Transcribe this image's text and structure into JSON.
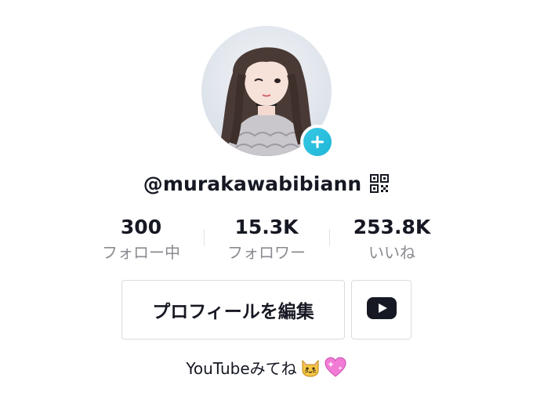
{
  "profile": {
    "username": "@murakawabibiann",
    "bio_text": "YouTubeみてね",
    "bio_emojis": [
      "cat-face-icon",
      "sparkling-heart-icon"
    ]
  },
  "stats": [
    {
      "value": "300",
      "label": "フォロー中"
    },
    {
      "value": "15.3K",
      "label": "フォロワー"
    },
    {
      "value": "253.8K",
      "label": "いいね"
    }
  ],
  "actions": {
    "edit_profile_label": "プロフィールを編集",
    "youtube_icon": "youtube-icon"
  },
  "icons": {
    "avatar_add": "plus-icon",
    "qr": "qr-code-icon"
  },
  "colors": {
    "add_badge": "#20d5ec",
    "secondary_text": "#8a8b91",
    "primary_text": "#161823",
    "youtube_icon": "#161823",
    "heart": "#f27bd6"
  }
}
